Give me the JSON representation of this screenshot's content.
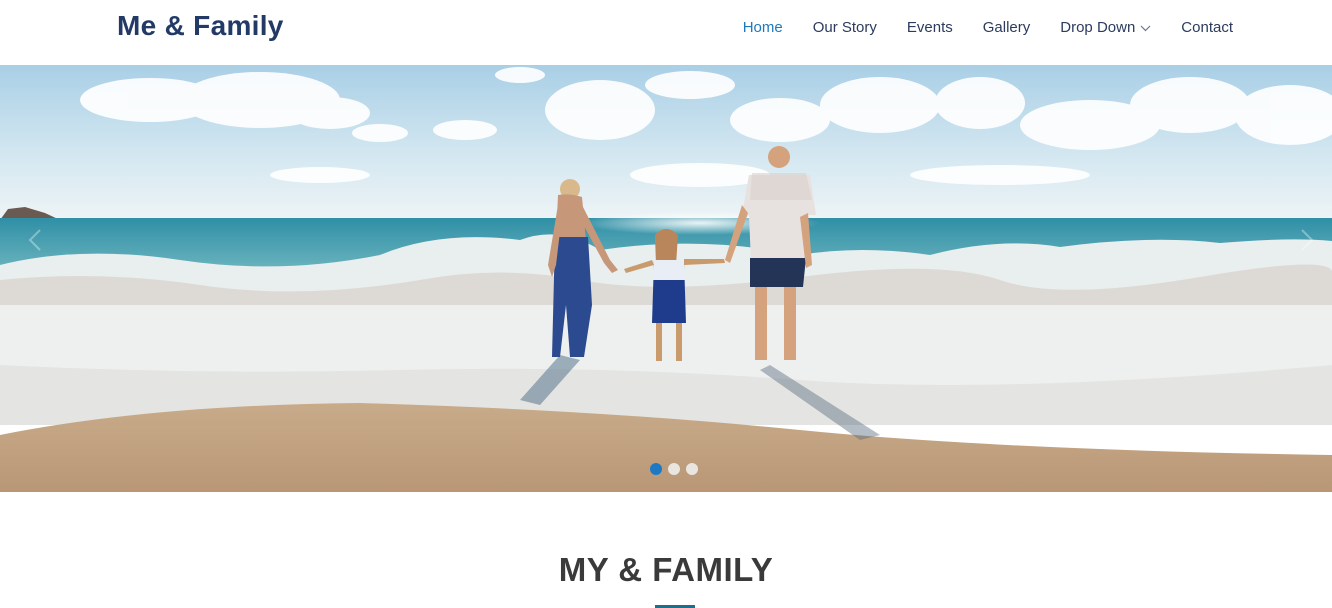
{
  "header": {
    "logo": "Me & Family",
    "nav": [
      {
        "label": "Home",
        "active": true
      },
      {
        "label": "Our Story"
      },
      {
        "label": "Events"
      },
      {
        "label": "Gallery"
      },
      {
        "label": "Drop Down",
        "dropdown": true
      },
      {
        "label": "Contact"
      }
    ]
  },
  "hero": {
    "image": "family-on-beach-photo",
    "slides_total": 3,
    "active_slide": 1
  },
  "section": {
    "title": "MY & FAMILY"
  },
  "colors": {
    "brand": "#233a67",
    "accent": "#1e7ab8",
    "nav_text": "#2c3b5e",
    "title": "#3a3a3a"
  }
}
